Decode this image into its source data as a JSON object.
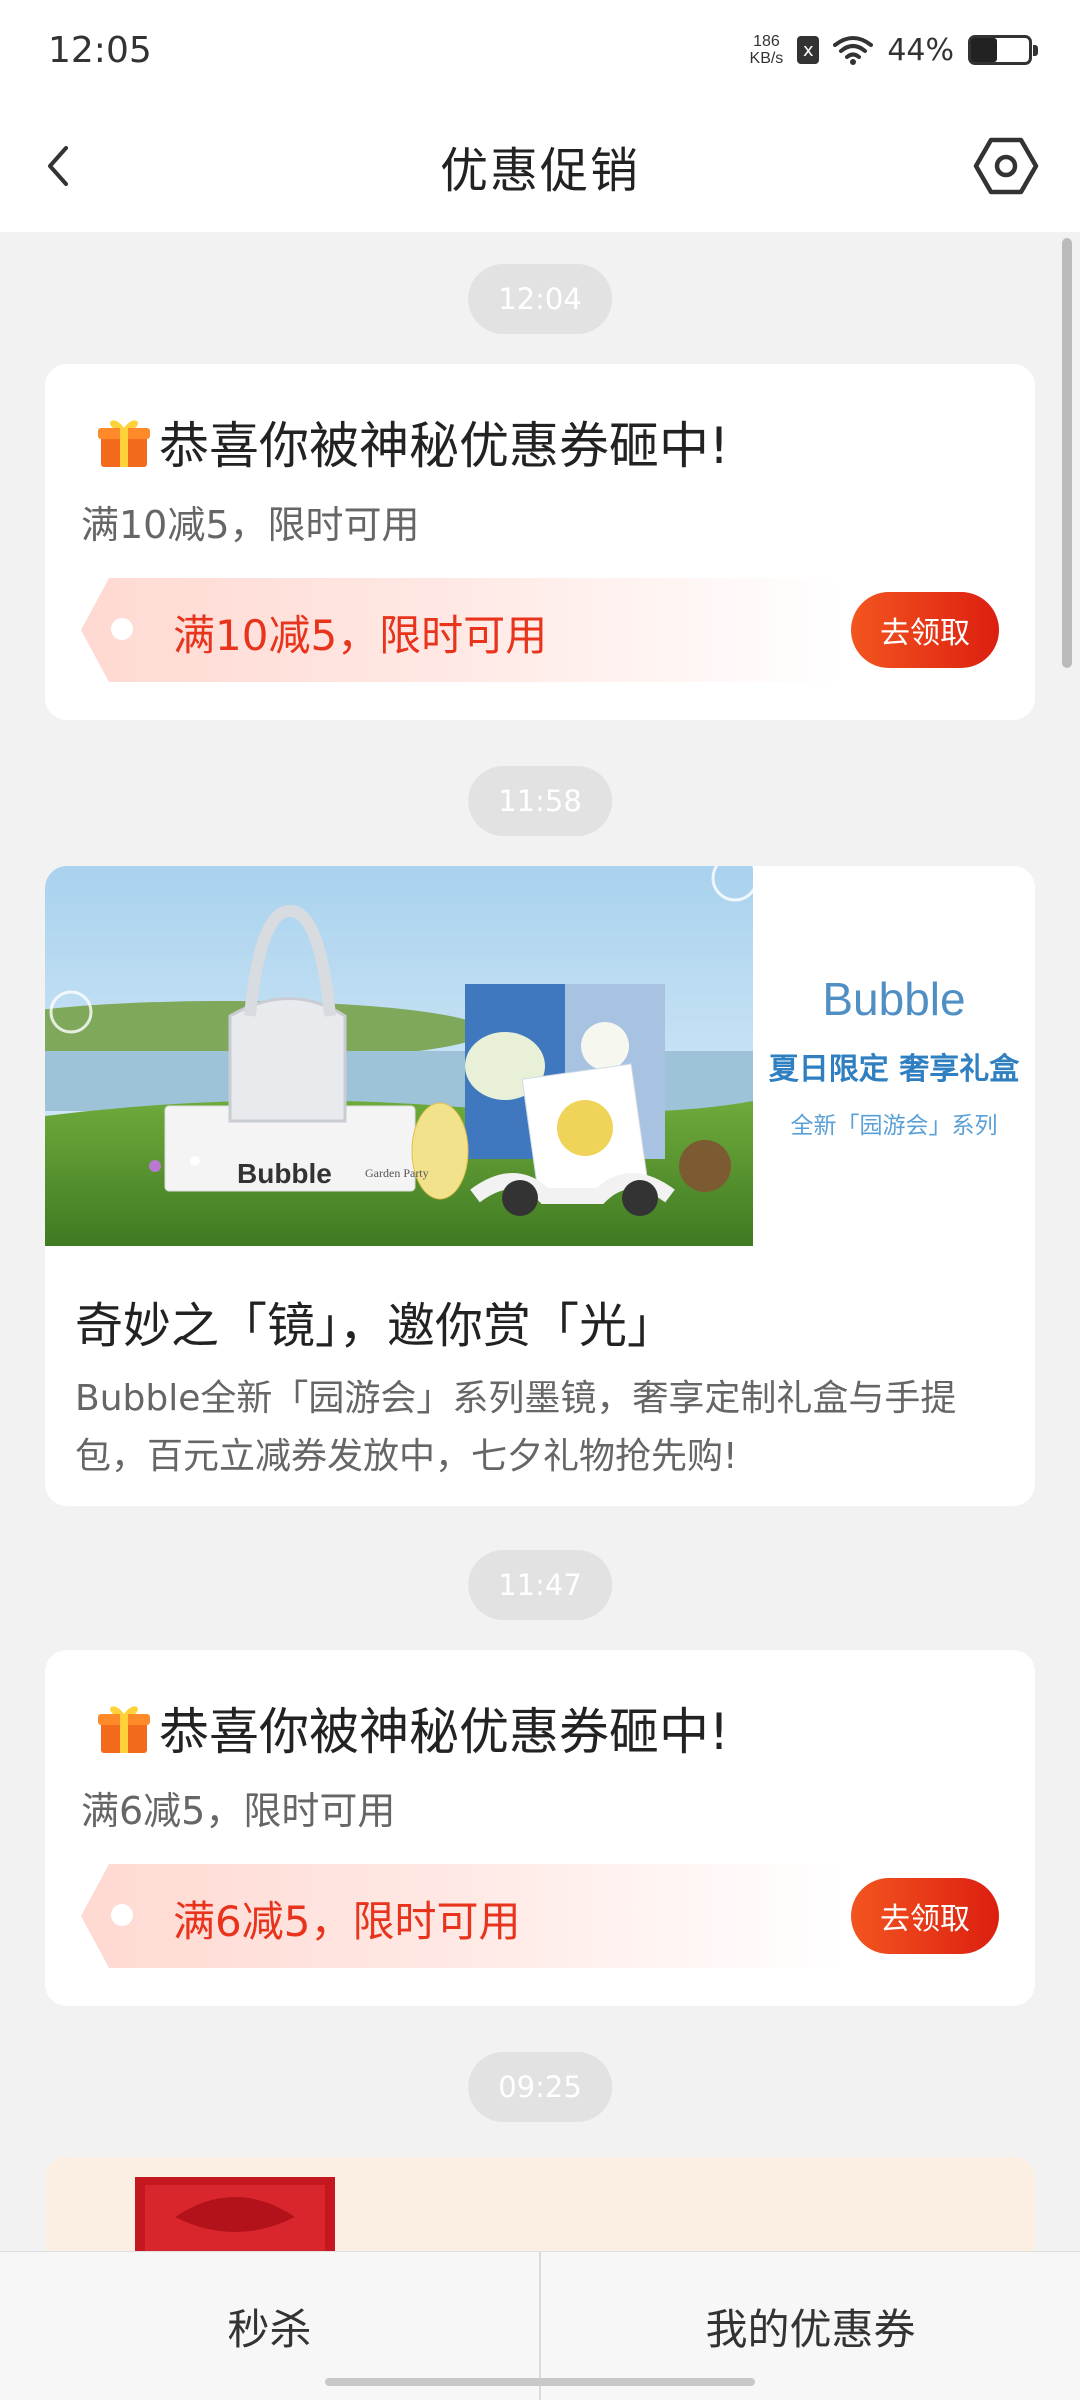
{
  "status_bar": {
    "time": "12:05",
    "net_speed_value": "186",
    "net_speed_unit": "KB/s",
    "sim_label": "x",
    "battery_percent": "44%",
    "battery_level": 0.44
  },
  "header": {
    "title": "优惠促销"
  },
  "feed": [
    {
      "type": "time",
      "text": "12:04"
    },
    {
      "type": "coupon",
      "title": "恭喜你被神秘优惠券砸中!",
      "subtitle": "满10减5，限时可用",
      "ticket_text": "满10减5，限时可用",
      "button_label": "去领取"
    },
    {
      "type": "time",
      "text": "11:58"
    },
    {
      "type": "promo",
      "banner_brand": "Bubble",
      "banner_line1": "夏日限定 奢享礼盒",
      "banner_line2": "全新「园游会」系列",
      "banner_product_label": "Bubble",
      "banner_product_small": "Garden Party",
      "title": "奇妙之「镜」，邀你赏「光」",
      "description": "Bubble全新「园游会」系列墨镜，奢享定制礼盒与手提包，百元立减券发放中，七夕礼物抢先购!"
    },
    {
      "type": "time",
      "text": "11:47"
    },
    {
      "type": "coupon",
      "title": "恭喜你被神秘优惠券砸中!",
      "subtitle": "满6减5，限时可用",
      "ticket_text": "满6减5，限时可用",
      "button_label": "去领取"
    },
    {
      "type": "time",
      "text": "09:25"
    }
  ],
  "bottom_nav": {
    "left_label": "秒杀",
    "right_label": "我的优惠券"
  },
  "colors": {
    "accent_red": "#e8341c",
    "background": "#f2f2f2",
    "brand_blue": "#4f8fc4"
  }
}
